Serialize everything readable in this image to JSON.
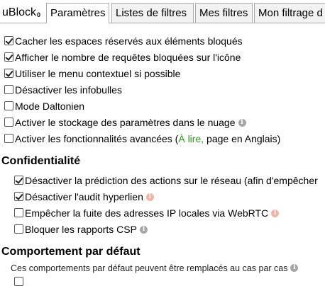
{
  "app": {
    "logo_text": "uBlock",
    "logo_suffix": "0"
  },
  "tabs": [
    {
      "label": "Paramètres",
      "active": true
    },
    {
      "label": "Listes de filtres",
      "active": false
    },
    {
      "label": "Mes filtres",
      "active": false
    },
    {
      "label": "Mon filtrage d",
      "active": false
    }
  ],
  "general_settings": [
    {
      "label": "Cacher les espaces réservés aux éléments bloqués",
      "checked": true
    },
    {
      "label": "Afficher le nombre de requêtes bloquées sur l'icône",
      "checked": true
    },
    {
      "label": "Utiliser le menu contextuel si possible",
      "checked": true
    },
    {
      "label": "Désactiver les infobulles",
      "checked": false
    },
    {
      "label": "Mode Daltonien",
      "checked": false
    },
    {
      "label": "Activer le stockage des paramètres dans le nuage",
      "checked": false,
      "info": "i"
    },
    {
      "label_before": "Activer les fonctionnalités avancées (",
      "link": "À lire,",
      "label_after": " page en Anglais)",
      "checked": false
    }
  ],
  "privacy": {
    "heading": "Confidentialité",
    "items": [
      {
        "label": "Désactiver la prédiction des actions sur le réseau (afin d'empêcher",
        "checked": true
      },
      {
        "label": "Désactiver l'audit hyperlien",
        "checked": true,
        "info": "i"
      },
      {
        "label": "Empêcher la fuite des adresses IP locales via WebRTC",
        "checked": false,
        "info": "i"
      },
      {
        "label": "Bloquer les rapports CSP",
        "checked": false,
        "info": "i"
      }
    ]
  },
  "default_behavior": {
    "heading": "Comportement par défaut",
    "note": "Ces comportements par défaut peuvent être remplacés au cas par cas",
    "info": "i"
  },
  "colors": {
    "link_green": "#2a9a1a",
    "info_grey": "#a6a6a6",
    "info_warn": "#f3b3a4"
  }
}
